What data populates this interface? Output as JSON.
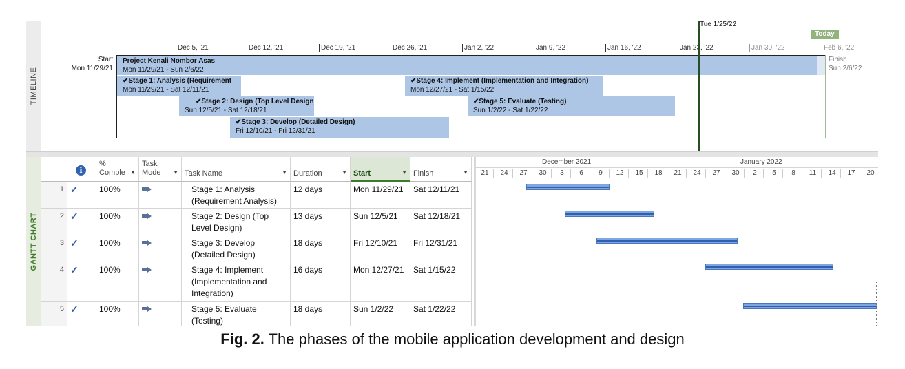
{
  "side_labels": {
    "timeline": "TIMELINE",
    "gantt": "GANTT CHART"
  },
  "timeline": {
    "ticks": [
      "Dec 5, '21",
      "Dec 12, '21",
      "Dec 19, '21",
      "Dec 26, '21",
      "Jan 2, '22",
      "Jan 9, '22",
      "Jan 16, '22",
      "Jan 23, '22",
      "Jan 30, '22",
      "Feb 6, '22"
    ],
    "today_marker": "Tue 1/25/22",
    "today_badge": "Today",
    "start_label": "Start",
    "start_date": "Mon 11/29/21",
    "finish_label": "Finish",
    "finish_date": "Sun 2/6/22",
    "project": {
      "name": "Project Kenali Nombor Asas",
      "dates": "Mon 11/29/21 - Sun 2/6/22"
    },
    "stages": [
      {
        "name": "Stage 1: Analysis (Requirement",
        "dates": "Mon 11/29/21 - Sat 12/11/21"
      },
      {
        "name": "Stage 2: Design (Top Level Design)",
        "dates": "Sun 12/5/21 - Sat 12/18/21"
      },
      {
        "name": "Stage 3: Develop (Detailed Design)",
        "dates": "Fri 12/10/21 - Fri 12/31/21"
      },
      {
        "name": "Stage 4: Implement (Implementation and Integration)",
        "dates": "Mon 12/27/21 - Sat 1/15/22"
      },
      {
        "name": "Stage 5: Evaluate (Testing)",
        "dates": "Sun 1/2/22 - Sat 1/22/22"
      }
    ],
    "check_glyph": "✔"
  },
  "table": {
    "headers": {
      "info": "i",
      "percent": "% Comple",
      "mode": "Task Mode",
      "name": "Task Name",
      "duration": "Duration",
      "start": "Start",
      "finish": "Finish"
    },
    "rows": [
      {
        "id": "1",
        "check": "✓",
        "percent": "100%",
        "name": "Stage 1: Analysis (Requirement Analysis)",
        "duration": "12 days",
        "start": "Mon 11/29/21",
        "finish": "Sat 12/11/21"
      },
      {
        "id": "2",
        "check": "✓",
        "percent": "100%",
        "name": "Stage 2: Design (Top Level Design)",
        "duration": "13 days",
        "start": "Sun 12/5/21",
        "finish": "Sat 12/18/21"
      },
      {
        "id": "3",
        "check": "✓",
        "percent": "100%",
        "name": "Stage 3: Develop (Detailed Design)",
        "duration": "18 days",
        "start": "Fri 12/10/21",
        "finish": "Fri 12/31/21"
      },
      {
        "id": "4",
        "check": "✓",
        "percent": "100%",
        "name": "Stage 4: Implement (Implementation and Integration)",
        "duration": "16 days",
        "start": "Mon 12/27/21",
        "finish": "Sat 1/15/22"
      },
      {
        "id": "5",
        "check": "✓",
        "percent": "100%",
        "name": "Stage 5: Evaluate (Testing)",
        "duration": "18 days",
        "start": "Sun 1/2/22",
        "finish": "Sat 1/22/22"
      }
    ]
  },
  "chart": {
    "months": [
      "December 2021",
      "January 2022"
    ],
    "days": [
      "21",
      "24",
      "27",
      "30",
      "3",
      "6",
      "9",
      "12",
      "15",
      "18",
      "21",
      "24",
      "27",
      "30",
      "2",
      "5",
      "8",
      "11",
      "14",
      "17",
      "20"
    ]
  },
  "caption": {
    "label": "Fig. 2.",
    "text": "The phases of the mobile application development and design"
  },
  "colors": {
    "timeline_bar": "#aec6e6",
    "gantt_bar": "#7ea6df",
    "today_line": "#284e24",
    "today_badge": "#93b37e"
  }
}
